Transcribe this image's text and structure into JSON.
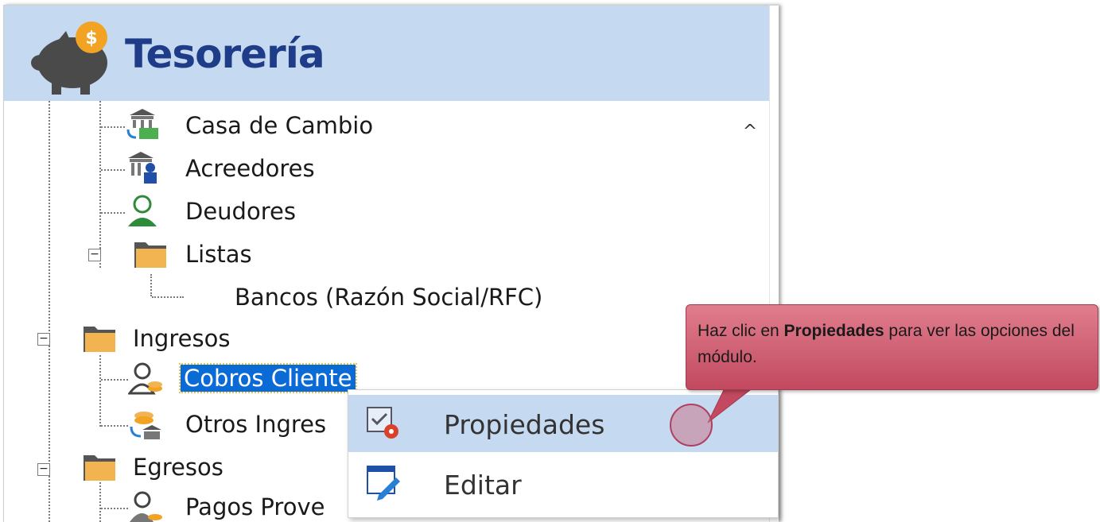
{
  "header": {
    "title": "Tesorería",
    "icon": "piggy-bank-icon",
    "accent_color": "#c5d9f1",
    "title_color": "#1f3c88"
  },
  "tree": {
    "items": [
      {
        "label": "Casa de Cambio",
        "icon": "currency-exchange-icon"
      },
      {
        "label": "Acreedores",
        "icon": "creditor-bank-icon"
      },
      {
        "label": "Deudores",
        "icon": "debtor-person-icon"
      },
      {
        "label": "Listas",
        "icon": "folder-icon"
      },
      {
        "label": "Bancos (Razón Social/RFC)",
        "icon": ""
      },
      {
        "label": "Ingresos",
        "icon": "folder-icon"
      },
      {
        "label": "Cobros Cliente",
        "icon": "client-payments-icon",
        "selected": true
      },
      {
        "label": "Otros Ingres",
        "icon": "other-income-icon"
      },
      {
        "label": "Egresos",
        "icon": "folder-icon"
      },
      {
        "label": "Pagos Prove",
        "icon": "supplier-payments-icon"
      }
    ],
    "expanders": [
      "⊟",
      "⊟",
      "⊟"
    ]
  },
  "context_menu": {
    "items": [
      {
        "label": "Propiedades",
        "icon": "properties-gear-icon",
        "highlighted": true
      },
      {
        "label": "Editar",
        "icon": "edit-window-icon"
      }
    ]
  },
  "callout": {
    "prefix": "Haz clic en ",
    "bold": "Propiedades",
    "suffix": " para ver las opciones del módulo.",
    "color": "#c2495f"
  }
}
